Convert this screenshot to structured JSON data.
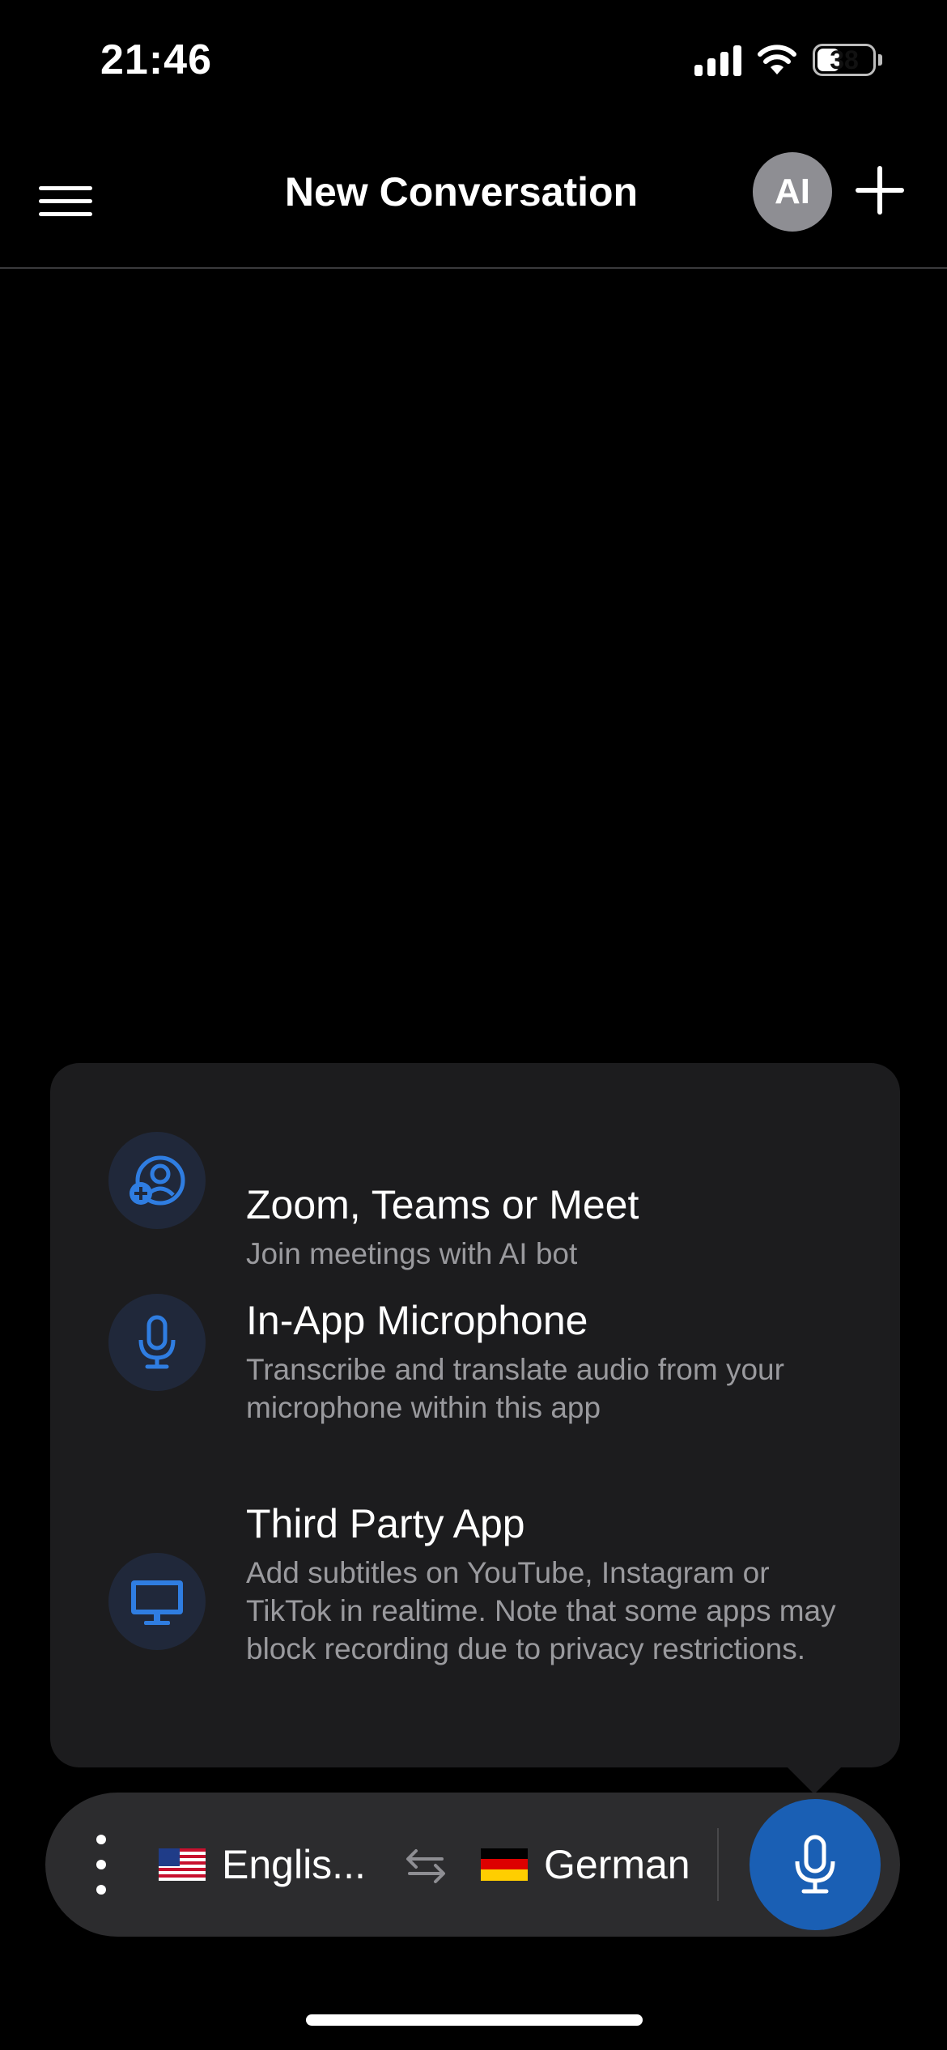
{
  "status_bar": {
    "time": "21:46",
    "battery_level": "38"
  },
  "header": {
    "title": "New Conversation",
    "avatar_initials": "AI",
    "menu_icon": "hamburger-menu-icon",
    "new_icon": "plus-icon"
  },
  "popup": {
    "options": [
      {
        "title": "Zoom, Teams or Meet",
        "description": "Join meetings with AI bot",
        "icon": "meeting-bot-icon"
      },
      {
        "title": "In-App Microphone",
        "description": "Transcribe and translate audio from your microphone within this app",
        "icon": "microphone-icon"
      },
      {
        "title": "Third Party App",
        "description": "Add subtitles on YouTube, Instagram or TikTok in realtime. Note that some apps may block recording due to privacy restrictions.",
        "icon": "monitor-icon"
      }
    ]
  },
  "bottom_bar": {
    "source_language": "Englis...",
    "target_language": "German",
    "source_flag": "us-flag-icon",
    "target_flag": "de-flag-icon",
    "swap_icon": "swap-arrows-icon",
    "record_icon": "microphone-icon"
  },
  "colors": {
    "background": "#000000",
    "popup_background": "#1c1c1e",
    "bar_background": "#2c2c2e",
    "accent_blue": "#1a5fb4",
    "icon_blue": "#2f7de1",
    "secondary_text": "#9a9a9e",
    "avatar_gray": "#8e8e93"
  }
}
